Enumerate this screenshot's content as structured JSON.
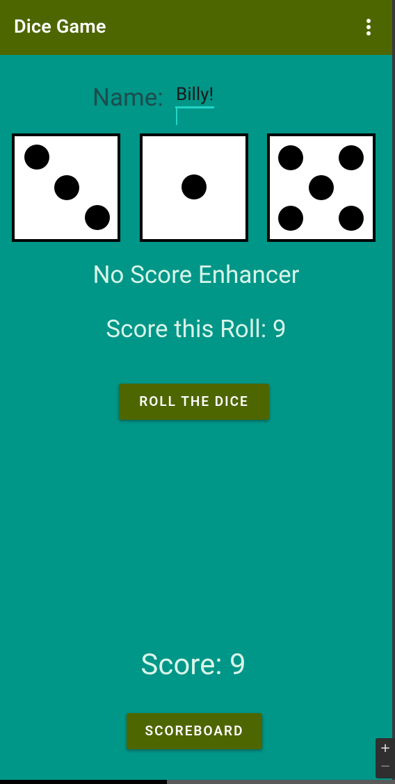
{
  "app_bar": {
    "title": "Dice Game",
    "menu_icon": "more-vert-icon"
  },
  "player": {
    "name_label": "Name:",
    "name_value": "Billy!"
  },
  "dice": [
    {
      "value": 3,
      "icon": "die-face-3-icon"
    },
    {
      "value": 1,
      "icon": "die-face-1-icon"
    },
    {
      "value": 5,
      "icon": "die-face-5-icon"
    }
  ],
  "status": {
    "enhancer_text": "No Score Enhancer",
    "roll_score_text": "Score this Roll: 9"
  },
  "buttons": {
    "roll_label": "ROLL THE DICE",
    "scoreboard_label": "SCOREBOARD"
  },
  "total": {
    "score_text": "Score: 9"
  },
  "zoom": {
    "in_glyph": "+",
    "out_glyph": "−"
  },
  "colors": {
    "app_bar": "#4e6600",
    "background": "#009688",
    "button": "#4e6600",
    "accent_underline": "#21d6c7",
    "text_light": "#d8f5e8"
  }
}
